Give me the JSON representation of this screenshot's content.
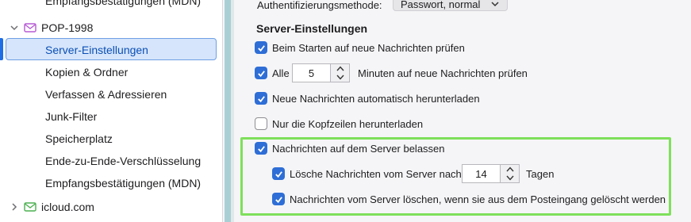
{
  "sidebar": {
    "top_item": "Empfangsbestätigungen (MDN)",
    "account1": {
      "name": "POP-1998"
    },
    "items": [
      "Server-Einstellungen",
      "Kopien & Ordner",
      "Verfassen & Adressieren",
      "Junk-Filter",
      "Speicherplatz",
      "Ende-zu-Ende-Verschlüsselung",
      "Empfangsbestätigungen (MDN)"
    ],
    "account2": {
      "name": "icloud.com"
    }
  },
  "content": {
    "auth_label": "Authentifizierungsmethode:",
    "auth_value": "Passwort, normal",
    "section_title": "Server-Einstellungen",
    "opt_check_start": "Beim Starten auf neue Nachrichten prüfen",
    "opt_every_prefix": "Alle",
    "opt_every_value": "5",
    "opt_every_suffix": "Minuten auf neue Nachrichten prüfen",
    "opt_auto_download": "Neue Nachrichten automatisch herunterladen",
    "opt_headers_only": "Nur die Kopfzeilen herunterladen",
    "opt_leave_on_server": "Nachrichten auf dem Server belassen",
    "opt_delete_after_prefix": "Lösche Nachrichten vom Server nach",
    "opt_delete_after_value": "14",
    "opt_delete_after_suffix": "Tagen",
    "opt_delete_when_removed": "Nachrichten vom Server löschen, wenn sie aus dem Posteingang gelöscht werden"
  },
  "colors": {
    "accent": "#2e6ed6",
    "highlight_box": "#7ee05b"
  }
}
